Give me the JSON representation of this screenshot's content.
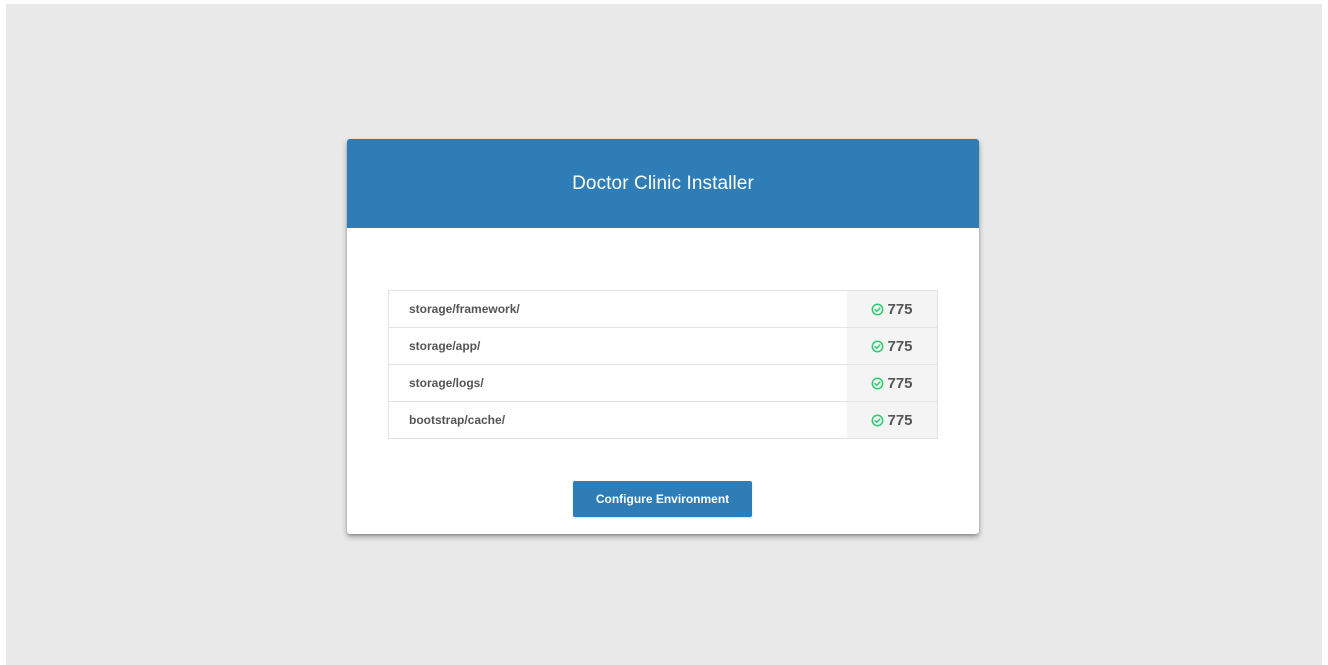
{
  "colors": {
    "accent": "#2e7db6",
    "success": "#2ecc71",
    "background": "#e9e9e9"
  },
  "installer": {
    "title": "Doctor Clinic Installer",
    "permissions": [
      {
        "path": "storage/framework/",
        "value": "775",
        "status_icon": "check-circle-icon"
      },
      {
        "path": "storage/app/",
        "value": "775",
        "status_icon": "check-circle-icon"
      },
      {
        "path": "storage/logs/",
        "value": "775",
        "status_icon": "check-circle-icon"
      },
      {
        "path": "bootstrap/cache/",
        "value": "775",
        "status_icon": "check-circle-icon"
      }
    ],
    "configure_label": "Configure Environment"
  }
}
